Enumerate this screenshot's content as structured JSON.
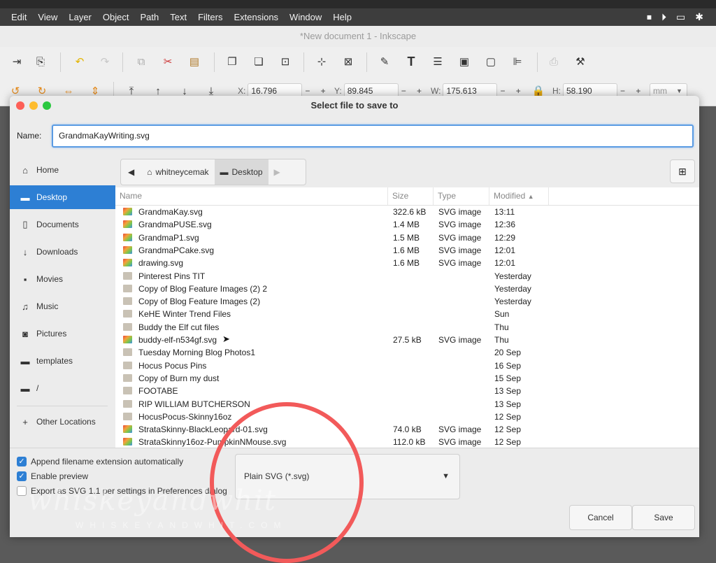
{
  "menubar": {
    "items": [
      "Edit",
      "View",
      "Layer",
      "Object",
      "Path",
      "Text",
      "Filters",
      "Extensions",
      "Window",
      "Help"
    ]
  },
  "window": {
    "title": "*New document 1 - Inkscape"
  },
  "toolbar": {
    "x_label": "X:",
    "x_value": "16.796",
    "y_label": "Y:",
    "y_value": "89.845",
    "w_label": "W:",
    "w_value": "175.613",
    "h_label": "H:",
    "h_value": "58.190",
    "unit": "mm",
    "pm": "− +"
  },
  "dialog": {
    "title": "Select file to save to",
    "name_label": "Name:",
    "name_value": "GrandmaKayWriting.svg",
    "sidebar": [
      {
        "label": "Home",
        "icon": "home-icon"
      },
      {
        "label": "Desktop",
        "icon": "folder-icon",
        "active": true
      },
      {
        "label": "Documents",
        "icon": "document-icon"
      },
      {
        "label": "Downloads",
        "icon": "download-icon"
      },
      {
        "label": "Movies",
        "icon": "movie-icon"
      },
      {
        "label": "Music",
        "icon": "music-icon"
      },
      {
        "label": "Pictures",
        "icon": "camera-icon"
      },
      {
        "label": "templates",
        "icon": "folder-icon"
      },
      {
        "label": "/",
        "icon": "folder-icon"
      },
      {
        "label": "Other Locations",
        "icon": "plus-icon"
      }
    ],
    "path": {
      "home": "whitneycemak",
      "current": "Desktop"
    },
    "columns": {
      "name": "Name",
      "size": "Size",
      "type": "Type",
      "modified": "Modified"
    },
    "files": [
      {
        "name": "GrandmaKay.svg",
        "size": "322.6 kB",
        "type": "SVG image",
        "modified": "13:11",
        "kind": "svg"
      },
      {
        "name": "GrandmaPUSE.svg",
        "size": "1.4 MB",
        "type": "SVG image",
        "modified": "12:36",
        "kind": "svg"
      },
      {
        "name": "GrandmaP1.svg",
        "size": "1.5 MB",
        "type": "SVG image",
        "modified": "12:29",
        "kind": "svg"
      },
      {
        "name": "GrandmaPCake.svg",
        "size": "1.6 MB",
        "type": "SVG image",
        "modified": "12:01",
        "kind": "svg"
      },
      {
        "name": "drawing.svg",
        "size": "1.6 MB",
        "type": "SVG image",
        "modified": "12:01",
        "kind": "svg"
      },
      {
        "name": "Pinterest Pins TIT",
        "size": "",
        "type": "",
        "modified": "Yesterday",
        "kind": "folder"
      },
      {
        "name": "Copy of Blog Feature Images (2) 2",
        "size": "",
        "type": "",
        "modified": "Yesterday",
        "kind": "folder"
      },
      {
        "name": "Copy of Blog Feature Images (2)",
        "size": "",
        "type": "",
        "modified": "Yesterday",
        "kind": "folder"
      },
      {
        "name": "KeHE Winter Trend Files",
        "size": "",
        "type": "",
        "modified": "Sun",
        "kind": "folder"
      },
      {
        "name": "Buddy the Elf cut files",
        "size": "",
        "type": "",
        "modified": "Thu",
        "kind": "folder"
      },
      {
        "name": "buddy-elf-n534gf.svg",
        "size": "27.5 kB",
        "type": "SVG image",
        "modified": "Thu",
        "kind": "svg"
      },
      {
        "name": "Tuesday Morning Blog Photos1",
        "size": "",
        "type": "",
        "modified": "20 Sep",
        "kind": "folder"
      },
      {
        "name": "Hocus Pocus Pins",
        "size": "",
        "type": "",
        "modified": "16 Sep",
        "kind": "folder"
      },
      {
        "name": "Copy of Burn my dust",
        "size": "",
        "type": "",
        "modified": "15 Sep",
        "kind": "folder"
      },
      {
        "name": "FOOTABE",
        "size": "",
        "type": "",
        "modified": "13 Sep",
        "kind": "folder"
      },
      {
        "name": "RIP WILLIAM BUTCHERSON",
        "size": "",
        "type": "",
        "modified": "13 Sep",
        "kind": "folder"
      },
      {
        "name": "HocusPocus-Skinny16oz",
        "size": "",
        "type": "",
        "modified": "12 Sep",
        "kind": "folder"
      },
      {
        "name": "StrataSkinny-BlackLeopard-01.svg",
        "size": "74.0 kB",
        "type": "SVG image",
        "modified": "12 Sep",
        "kind": "svg"
      },
      {
        "name": "StrataSkinny16oz-PumpkinNMouse.svg",
        "size": "112.0 kB",
        "type": "SVG image",
        "modified": "12 Sep",
        "kind": "svg"
      }
    ],
    "options": {
      "append_ext": "Append filename extension automatically",
      "enable_preview": "Enable preview",
      "export_svg11": "Export as SVG 1.1 per settings in Preferences dialog"
    },
    "filter_value": "Plain SVG (*.svg)",
    "cancel": "Cancel",
    "save": "Save"
  },
  "watermark": {
    "script": "whiskeyandwhit",
    "url": "WHISKEYANDWHIT.COM"
  },
  "colors": {
    "accent": "#2d7fd4",
    "annotation": "#f25a5a"
  }
}
